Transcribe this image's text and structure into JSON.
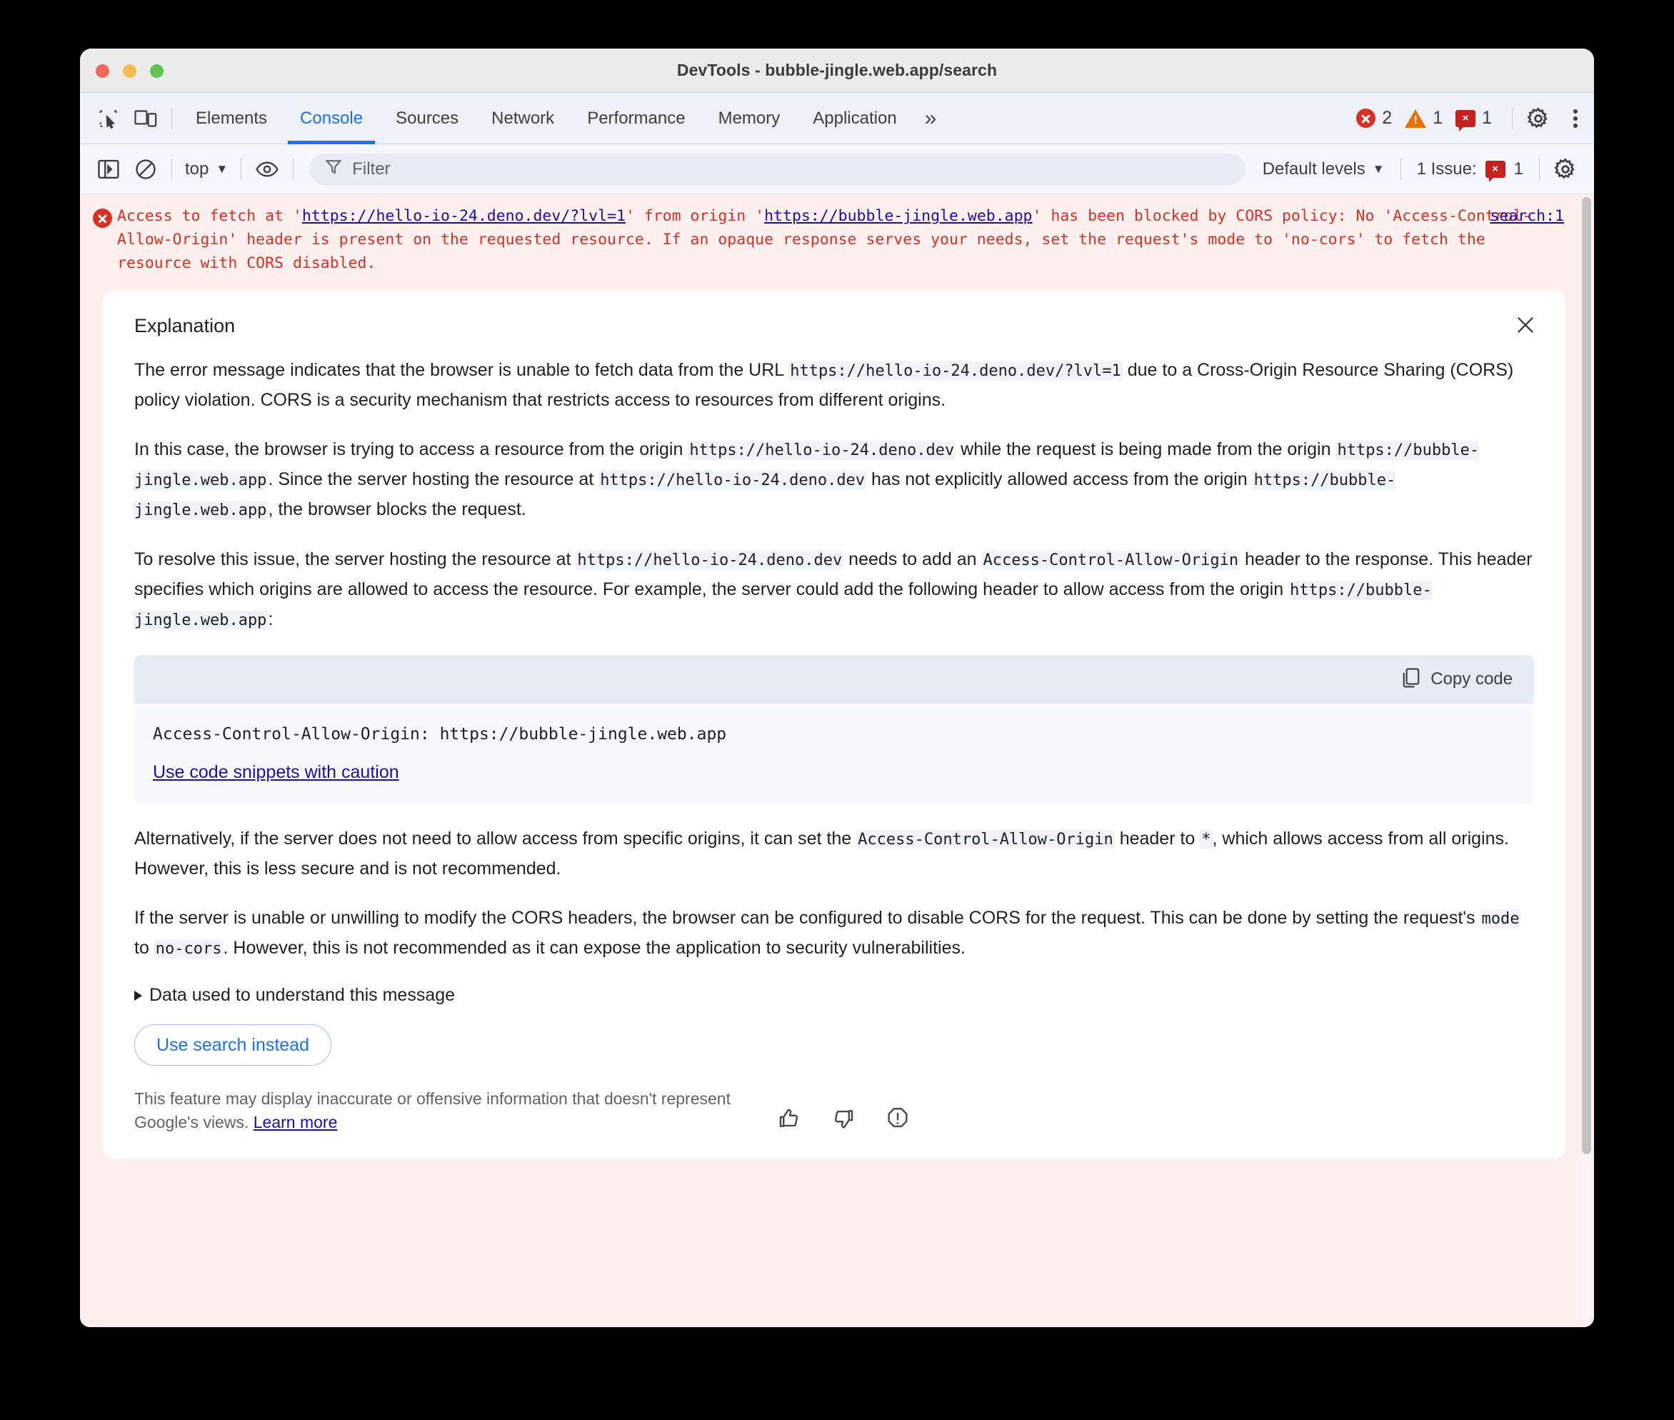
{
  "window": {
    "title": "DevTools - bubble-jingle.web.app/search",
    "traffic_lights": [
      "close",
      "minimize",
      "maximize"
    ]
  },
  "tabbar": {
    "inspect_icon": "inspect-element-icon",
    "device_icon": "device-toolbar-icon",
    "tabs": [
      {
        "label": "Elements",
        "active": false
      },
      {
        "label": "Console",
        "active": true
      },
      {
        "label": "Sources",
        "active": false
      },
      {
        "label": "Network",
        "active": false
      },
      {
        "label": "Performance",
        "active": false
      },
      {
        "label": "Memory",
        "active": false
      },
      {
        "label": "Application",
        "active": false
      }
    ],
    "more_tabs": "»",
    "counters": {
      "errors": "2",
      "warnings": "1",
      "issues": "1",
      "issue_glyph": "×"
    },
    "settings_icon": "gear-icon",
    "more_icon": "kebab-menu-icon"
  },
  "filterbar": {
    "sidebar_toggle_icon": "show-console-sidebar-icon",
    "clear_icon": "clear-console-icon",
    "context": "top",
    "eye_icon": "live-expressions-icon",
    "filter_icon": "filter-icon",
    "filter_placeholder": "Filter",
    "filter_value": "",
    "levels": "Default levels",
    "issues_label": "1 Issue:",
    "issues_count": "1",
    "issue_glyph": "×",
    "settings_icon": "console-settings-gear-icon"
  },
  "console": {
    "error": {
      "icon": "error-circle-icon",
      "prefix": "Access to fetch at '",
      "url1": "https://hello-io-24.deno.dev/?lvl=1",
      "mid": "' from origin '",
      "url2": "https://bubble-jingle.web.app",
      "suffix": "' has been blocked by CORS policy: No 'Access-Control-Allow-Origin' header is present on the requested resource. If an opaque response serves your needs, set the request's mode to 'no-cors' to fetch the resource with CORS disabled.",
      "source_link": "search:1"
    }
  },
  "explanation": {
    "title": "Explanation",
    "close_icon": "close-icon",
    "paragraph1": {
      "t1": "The error message indicates that the browser is unable to fetch data from the URL ",
      "c1": "https://hello-io-24.deno.dev/?lvl=1",
      "t2": " due to a Cross-Origin Resource Sharing (CORS) policy violation. CORS is a security mechanism that restricts access to resources from different origins."
    },
    "paragraph2": {
      "t1": "In this case, the browser is trying to access a resource from the origin ",
      "c1": "https://hello-io-24.deno.dev",
      "t2": " while the request is being made from the origin ",
      "c2": "https://bubble-jingle.web.app",
      "t3": ". Since the server hosting the resource at ",
      "c3": "https://hello-io-24.deno.dev",
      "t4": " has not explicitly allowed access from the origin ",
      "c4": "https://bubble-jingle.web.app",
      "t5": ", the browser blocks the request."
    },
    "paragraph3": {
      "t1": "To resolve this issue, the server hosting the resource at ",
      "c1": "https://hello-io-24.deno.dev",
      "t2": " needs to add an ",
      "c2": "Access-Control-Allow-Origin",
      "t3": " header to the response. This header specifies which origins are allowed to access the resource. For example, the server could add the following header to allow access from the origin ",
      "c3": "https://bubble-jingle.web.app",
      "t4": ":"
    },
    "code_block": {
      "copy_icon": "copy-icon",
      "copy_label": "Copy code",
      "code": "Access-Control-Allow-Origin: https://bubble-jingle.web.app",
      "caution_link": "Use code snippets with caution"
    },
    "paragraph4": {
      "t1": "Alternatively, if the server does not need to allow access from specific origins, it can set the ",
      "c1": "Access-Control-Allow-Origin",
      "t2": " header to ",
      "c2": "*",
      "t3": ", which allows access from all origins. However, this is less secure and is not recommended."
    },
    "paragraph5": {
      "t1": "If the server is unable or unwilling to modify the CORS headers, the browser can be configured to disable CORS for the request. This can be done by setting the request's ",
      "c1": "mode",
      "t2": " to ",
      "c2": "no-cors",
      "t3": ". However, this is not recommended as it can expose the application to security vulnerabilities."
    },
    "disclosure_label": "Data used to understand this message",
    "use_search_button": "Use search instead",
    "disclaimer": {
      "text": "This feature may display inaccurate or offensive information that doesn't represent Google's views. ",
      "link": "Learn more"
    },
    "feedback": {
      "thumb_up_icon": "thumb-up-icon",
      "thumb_down_icon": "thumb-down-icon",
      "report_icon": "report-icon"
    }
  },
  "colors": {
    "accent": "#1a73e8",
    "error": "#d93025",
    "warning": "#e8710a",
    "issue": "#c5221f",
    "link": "#1a0dab",
    "error_bg": "#fdf0ee"
  }
}
